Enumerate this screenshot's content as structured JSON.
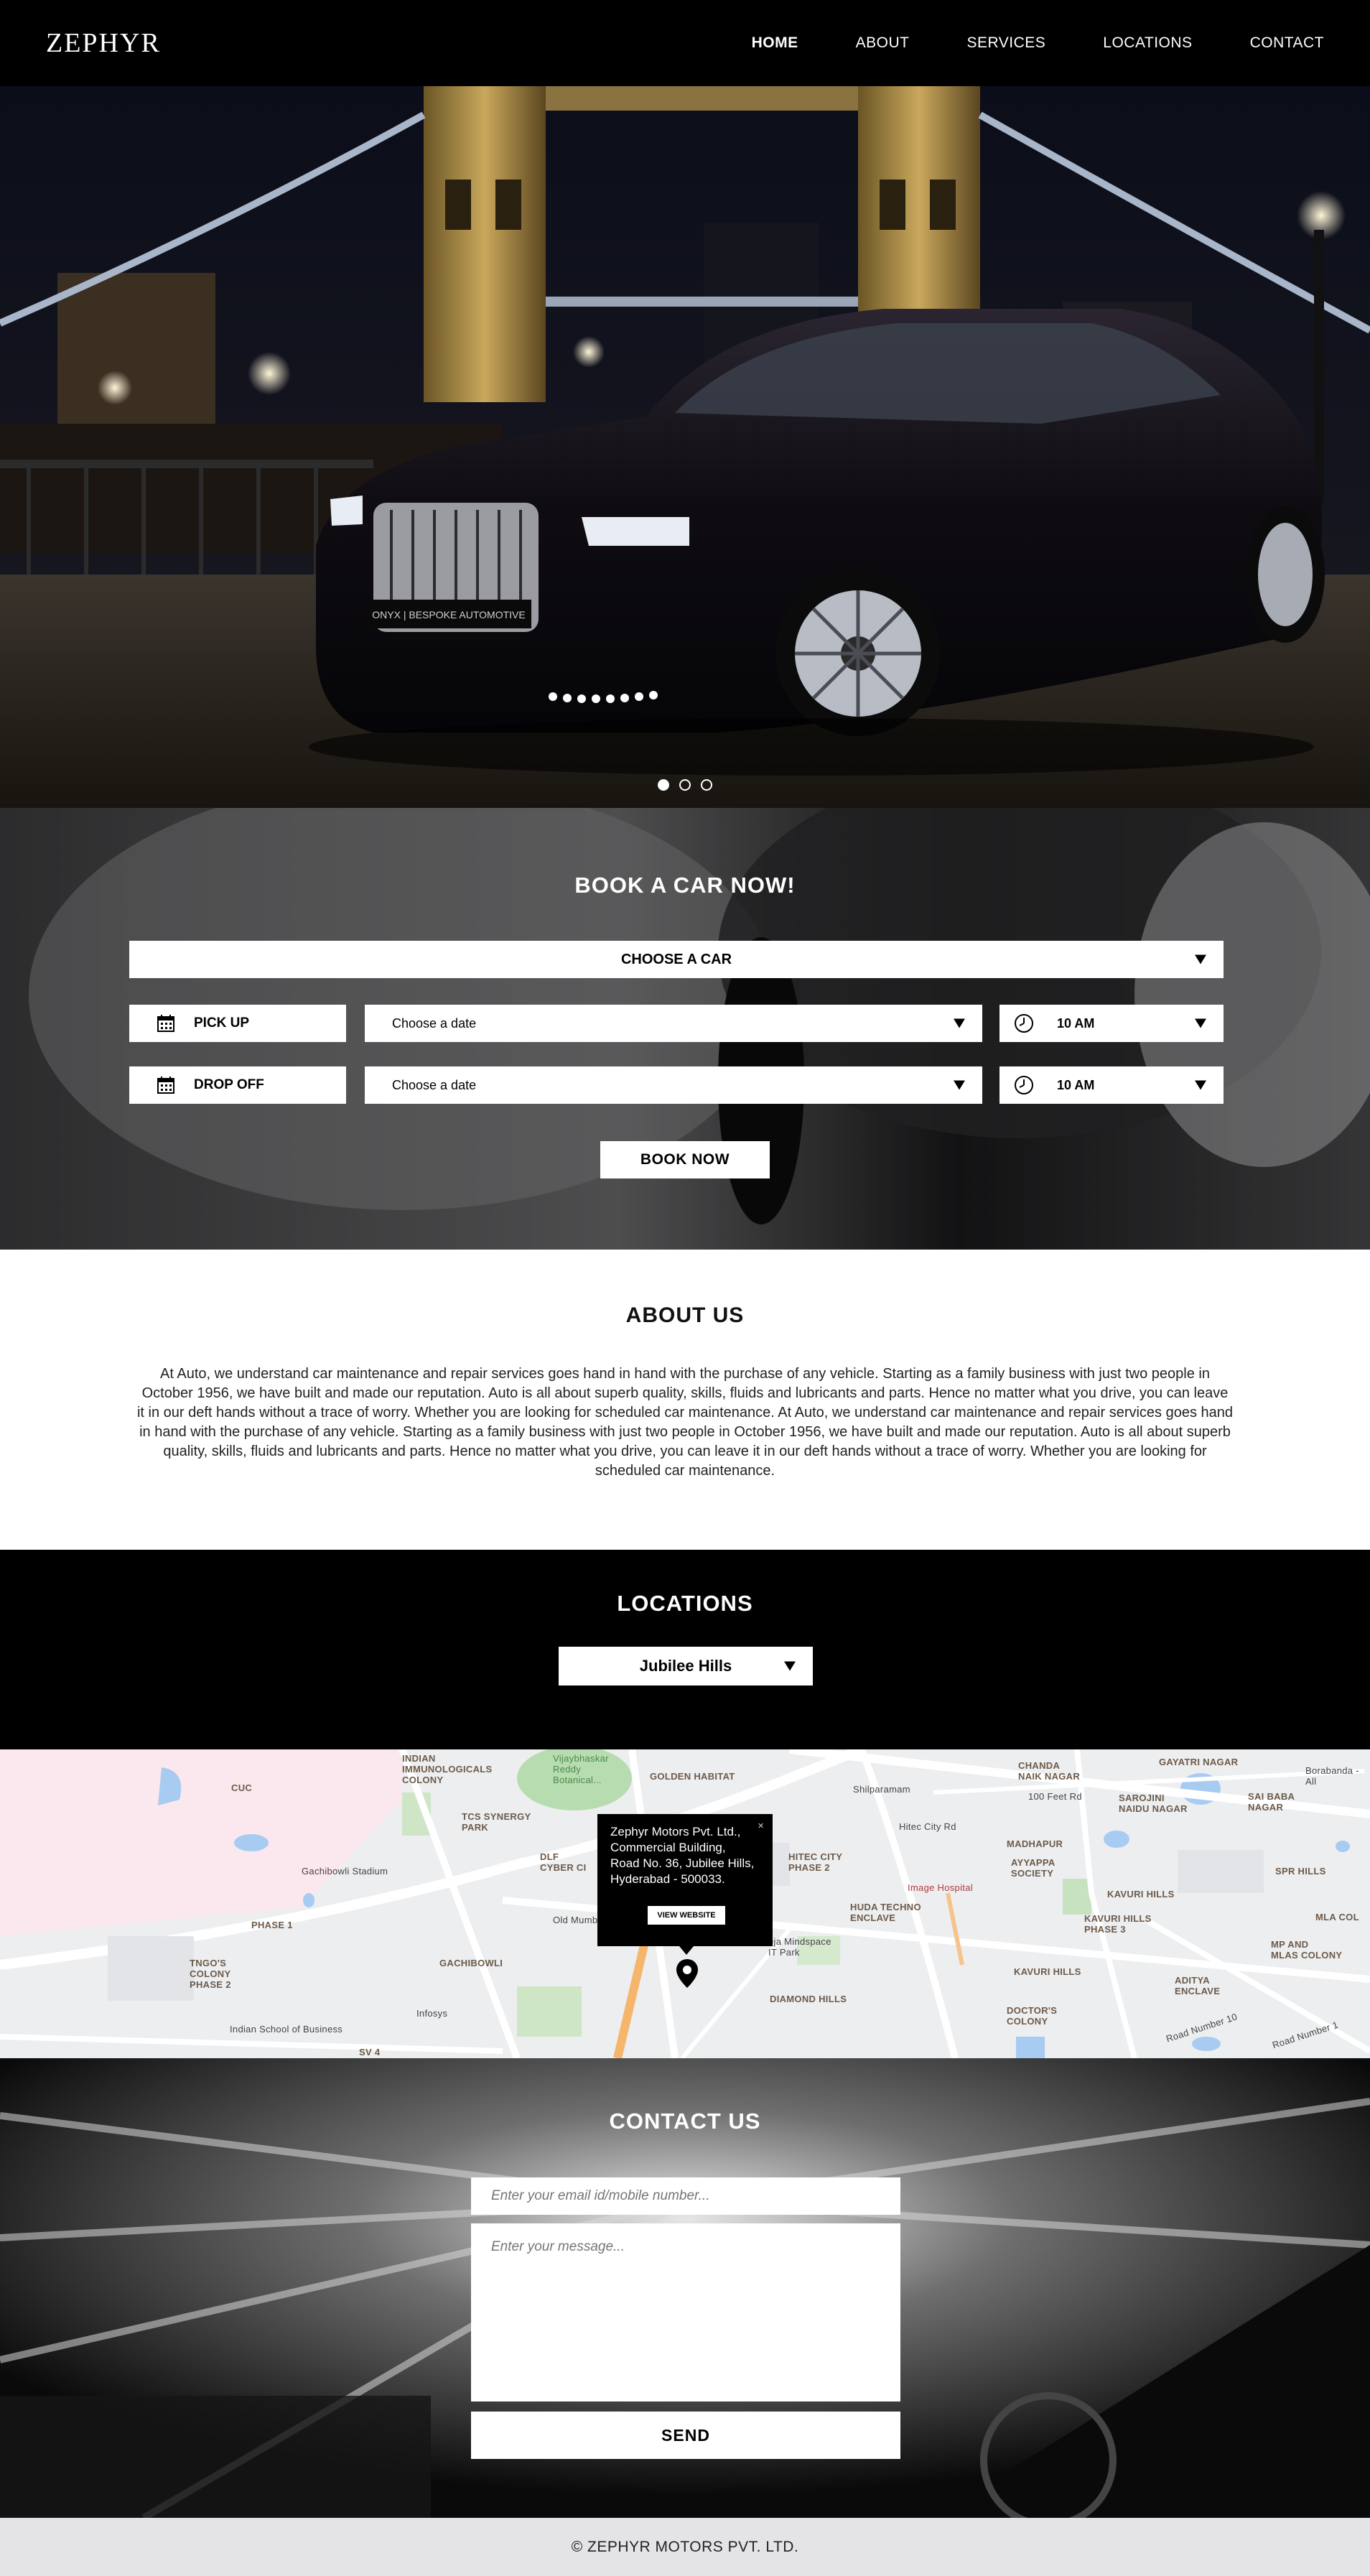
{
  "nav": {
    "logo": "ZEPHYR",
    "links": [
      "HOME",
      "ABOUT",
      "SERVICES",
      "LOCATIONS",
      "CONTACT"
    ]
  },
  "hero": {
    "car_badge": "ONYX | BESPOKE AUTOMOTIVE",
    "slide_count": 3,
    "active_slide": 1
  },
  "booking": {
    "title": "BOOK A CAR NOW!",
    "choose_car": "CHOOSE A CAR",
    "pickup": {
      "label": "PICK UP",
      "date_placeholder": "Choose a date",
      "time": "10 AM"
    },
    "dropoff": {
      "label": "DROP OFF",
      "date_placeholder": "Choose a date",
      "time": "10 AM"
    },
    "button": "BOOK NOW"
  },
  "about": {
    "title": "ABOUT US",
    "text": "At Auto, we understand car maintenance and repair services goes hand in hand with the purchase of any vehicle. Starting as a family business with just two people in October 1956, we have built and made our reputation. Auto is all about superb quality, skills, fluids and lubricants and parts. Hence no matter what you drive, you can leave it in our deft hands without a trace of worry. Whether you are looking for scheduled car maintenance. At Auto, we understand car maintenance and repair services goes hand in hand with the purchase of any vehicle. Starting as a family business with just two people in October 1956, we have built and made our reputation. Auto is all about superb quality, skills, fluids and lubricants and parts. Hence no matter what you drive, you can leave it in our deft hands without a trace of worry. Whether you are looking for scheduled car maintenance."
  },
  "locations": {
    "title": "LOCATIONS",
    "selected": "Jubilee Hills"
  },
  "map": {
    "info": {
      "line1": "Zephyr Motors Pvt. Ltd.,",
      "line2": "Commercial Building,",
      "line3": "Road No. 36, Jubilee Hills,",
      "line4": "Hyderabad - 500033.",
      "button": "VIEW WEBSITE",
      "close": "×"
    },
    "labels": {
      "cuc": "CUC",
      "immunological": "INDIAN\nIMMUNOLOGICALS\nCOLONY",
      "vijaybhaskar": "Vijaybhaskar\nReddy\nBotanical...",
      "golden": "GOLDEN HABITAT",
      "shilparamam": "Shilparamam",
      "chanda": "CHANDA\nNAIK NAGAR",
      "gayatri": "GAYATRI NAGAR",
      "borabanda": "Borabanda - All",
      "fertrd": "100 Feet Rd",
      "sarojini": "SAROJINI\nNAIDU NAGAR",
      "saibaba": "SAI BABA\nNAGAR",
      "tcs": "TCS SYNERGY\nPARK",
      "dlf": "DLF\nCYBER CI",
      "hitec": "HITEC CITY\nPHASE 2",
      "hitecrd": "Hitec City Rd",
      "madhapur": "MADHAPUR",
      "ayyappa": "AYYAPPA\nSOCIETY",
      "spr": "SPR HILLS",
      "gachibowlistad": "Gachibowli Stadium",
      "imagehosp": "Image Hospital",
      "hudatechno": "HUDA TECHNO\nENCLAVE",
      "kavuri": "KAVURI HILLS",
      "mla": "MLA COL",
      "phase1": "PHASE 1",
      "oldmumbai": "Old Mumbai Hwy",
      "raheja": "eja Mindspace\nIT Park",
      "kavuri3": "KAVURI HILLS\nPHASE 3",
      "mp": "MP AND\nMLAS COLONY",
      "tngo": "TNGO'S\nCOLONY\nPHASE 2",
      "gachibowli": "GACHIBOWLI",
      "kavuri2": "KAVURI HILLS",
      "aditya": "ADITYA\nENCLAVE",
      "diamond": "DIAMOND HILLS",
      "infosys": "Infosys",
      "isb": "Indian School of Business",
      "doctors": "DOCTOR'S\nCOLONY",
      "sv4": "SV 4",
      "roadno1": "Road Number 10",
      "roadno2": "Road Number 1"
    }
  },
  "contact": {
    "title": "CONTACT US",
    "email_placeholder": "Enter your email id/mobile number...",
    "message_placeholder": "Enter your message...",
    "button": "SEND"
  },
  "footer": {
    "text": "© ZEPHYR MOTORS PVT. LTD."
  }
}
